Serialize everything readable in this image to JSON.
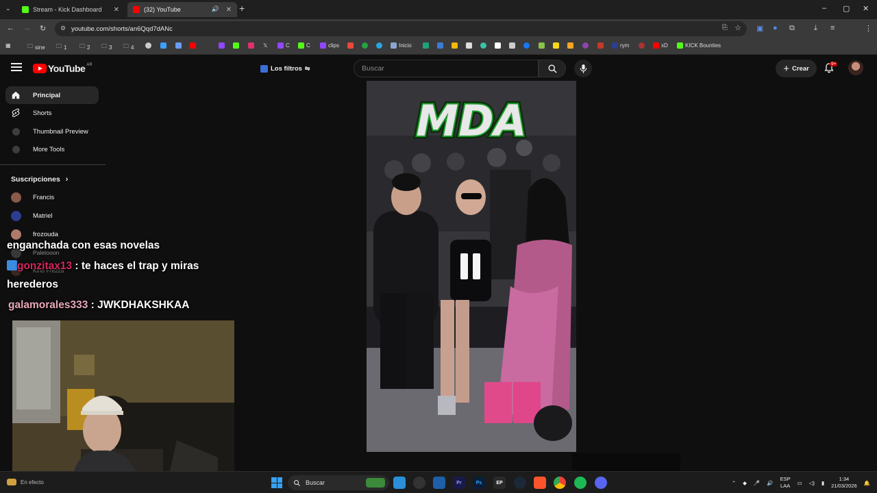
{
  "browser": {
    "tabs": [
      {
        "title": "Stream - Kick Dashboard",
        "active": false
      },
      {
        "title": "(32) YouTube",
        "active": true
      }
    ],
    "url": "youtube.com/shorts/an6Qqd7dANc",
    "bookmarks": [
      "sine",
      "1",
      "2",
      "3",
      "4",
      "C",
      "C",
      "clips",
      "Inicio",
      "rym",
      "xD",
      "KICK Bounties"
    ]
  },
  "masthead": {
    "logo_text": "YouTube",
    "country_code": "AR",
    "filters_label": "Los filtros",
    "search_placeholder": "Buscar",
    "create_label": "Crear",
    "notification_count": "9+"
  },
  "sidebar": {
    "items": [
      {
        "label": "Principal",
        "icon": "home-icon",
        "active": true
      },
      {
        "label": "Shorts",
        "icon": "shorts-icon",
        "active": false
      },
      {
        "label": "Thumbnail Preview",
        "icon": "extension-icon",
        "active": false
      },
      {
        "label": "More Tools",
        "icon": "extension-icon",
        "active": false
      }
    ],
    "subscriptions_title": "Suscripciones",
    "subscriptions": [
      {
        "name": "Francis",
        "color": "#8a5a4a"
      },
      {
        "name": "Matriel",
        "color": "#2c3e8f"
      },
      {
        "name": "frozouda",
        "color": "#b07a6a"
      },
      {
        "name": "Paletooon",
        "color": "#5a5a5a"
      },
      {
        "name": "Kino Frezza",
        "color": "#6a4a3a"
      }
    ]
  },
  "chat_overlay": {
    "line1": "enganchada con esas novelas",
    "line2_user": "gonzitax13",
    "line2_text": ": te haces el trap y miras",
    "line3": "herederos",
    "line4_user": "galamorales333",
    "line4_text": ": JWKDHAKSHKAA"
  },
  "short_video": {
    "overlay_text": "MDA",
    "state": "paused"
  },
  "taskbar": {
    "weather_text": "En efecto",
    "search_placeholder": "Buscar",
    "language_top": "ESP",
    "language_bottom": "LAA",
    "time": "1:34",
    "date": "21/03/2026"
  },
  "colors": {
    "youtube_red": "#ff0000",
    "background": "#0f0f0f",
    "mda_green": "#1e9e2e"
  }
}
